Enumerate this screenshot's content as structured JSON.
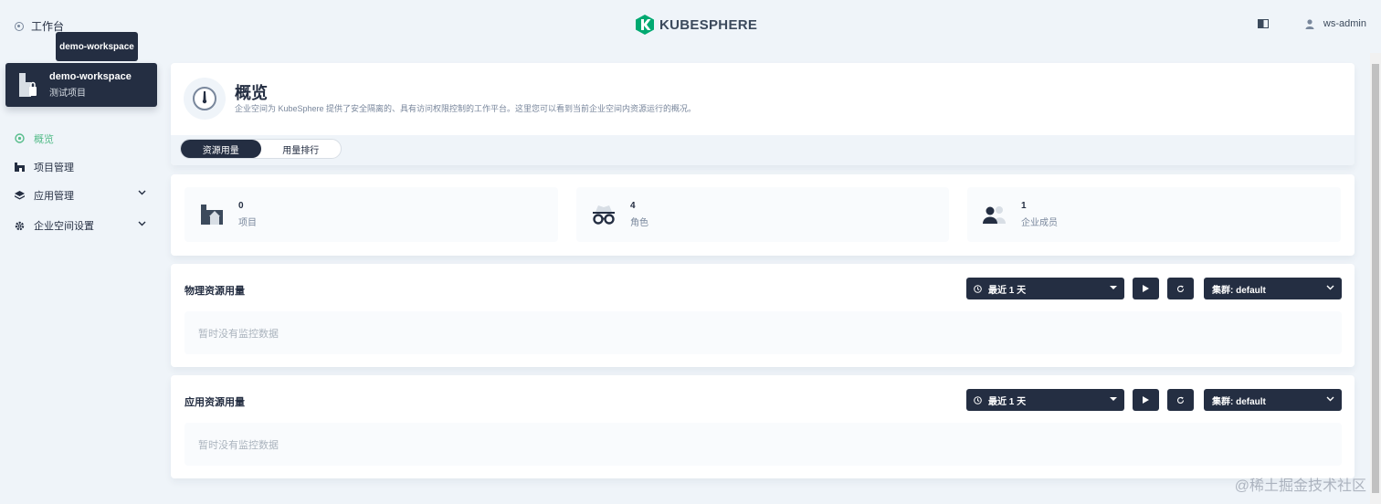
{
  "topbar": {
    "workbench_label": "工作台",
    "logo_text": "KUBESPHERE",
    "user_name": "ws-admin"
  },
  "tooltip": {
    "text": "demo-workspace"
  },
  "workspace": {
    "title": "demo-workspace",
    "subtitle": "测试项目"
  },
  "sidebar": {
    "items": [
      {
        "label": "概览",
        "icon": "overview-icon",
        "active": true
      },
      {
        "label": "项目管理",
        "icon": "project-icon"
      },
      {
        "label": "应用管理",
        "icon": "app-icon"
      },
      {
        "label": "企业空间设置",
        "icon": "gear-icon"
      }
    ]
  },
  "overview": {
    "title": "概览",
    "description": "企业空间为 KubeSphere 提供了安全隔离的、具有访问权限控制的工作平台。这里您可以看到当前企业空间内资源运行的概况。",
    "tabs": [
      "资源用量",
      "用量排行"
    ]
  },
  "stats": [
    {
      "count": "0",
      "label": "项目",
      "icon": "project-icon"
    },
    {
      "count": "4",
      "label": "角色",
      "icon": "role-icon"
    },
    {
      "count": "1",
      "label": "企业成员",
      "icon": "members-icon"
    }
  ],
  "physical_usage": {
    "title": "物理资源用量",
    "time_range": "最近 1 天",
    "cluster": "集群: default",
    "empty_text": "暂时没有监控数据"
  },
  "app_usage": {
    "title": "应用资源用量",
    "time_range": "最近 1 天",
    "cluster": "集群: default",
    "empty_text": "暂时没有监控数据"
  },
  "watermark": "@稀土掘金技术社区",
  "colors": {
    "accent": "#55bc8a",
    "dark": "#242e42",
    "background": "#eff4f9"
  }
}
